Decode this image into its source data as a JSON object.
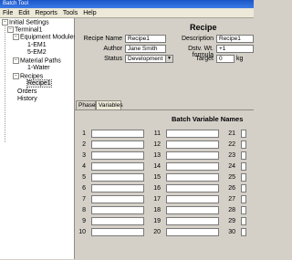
{
  "window": {
    "title": "Batch Tool"
  },
  "menu": {
    "items": [
      "File",
      "Edit",
      "Reports",
      "Tools",
      "Help"
    ]
  },
  "tree": {
    "root": "Initial Settings",
    "terminal": "Terminal1",
    "equipment_modules": "Equipment Modules",
    "em1": "1-EM1",
    "em2": "5-EM2",
    "material_paths": "Material Paths",
    "water": "1-Water",
    "recipes": "Recipes",
    "recipe1": "Recipe1",
    "orders": "Orders",
    "history": "History"
  },
  "recipe": {
    "heading": "Recipe",
    "name_label": "Recipe Name",
    "name_value": "Recipe1",
    "author_label": "Author",
    "author_value": "Jane Smith",
    "status_label": "Status",
    "status_value": "Development",
    "description_label": "Description",
    "description_value": "Recipe1",
    "formula_label": "Dstv. Wt. formula",
    "formula_value": "+1",
    "target_label": "Target",
    "target_value": "0",
    "target_unit": "kg"
  },
  "tabs": [
    "Phases",
    "Variables"
  ],
  "variables": {
    "heading": "Batch Variable Names",
    "col1": [
      "1",
      "2",
      "3",
      "4",
      "5",
      "6",
      "7",
      "8",
      "9",
      "10"
    ],
    "col2": [
      "11",
      "12",
      "13",
      "14",
      "15",
      "16",
      "17",
      "18",
      "19",
      "20"
    ],
    "col3": [
      "21",
      "22",
      "23",
      "24",
      "25",
      "26",
      "27",
      "28",
      "29",
      "30"
    ]
  }
}
